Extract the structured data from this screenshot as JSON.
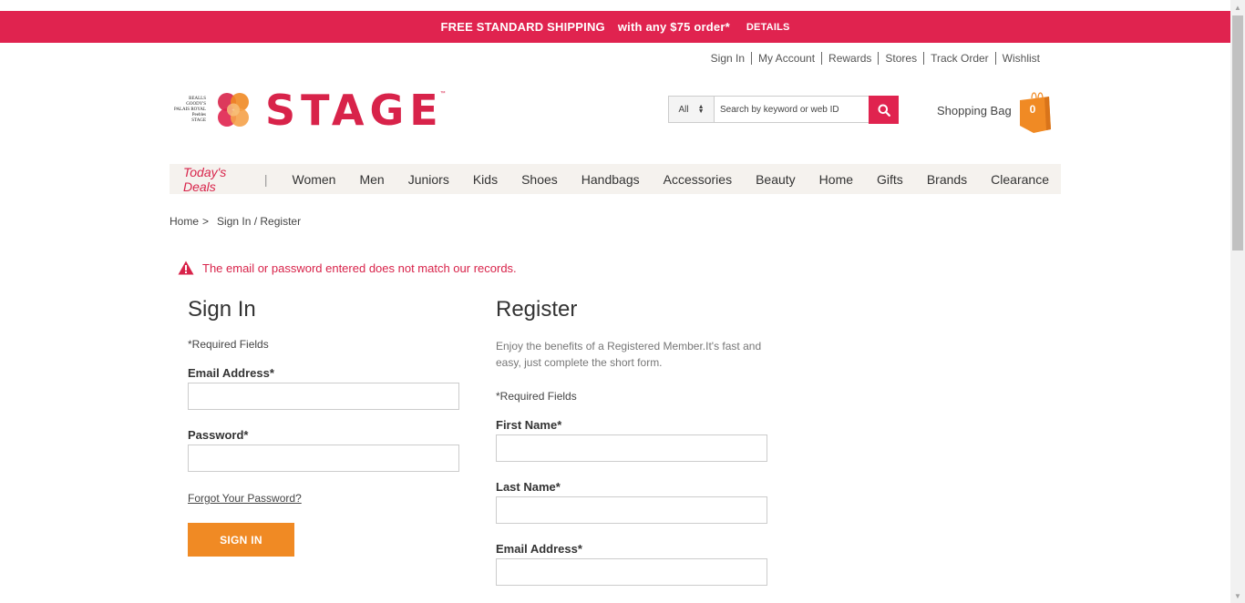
{
  "promo": {
    "headline": "FREE STANDARD SHIPPING",
    "condition": "with any $75 order*",
    "details": "DETAILS"
  },
  "util_links": [
    "Sign In",
    "My Account",
    "Rewards",
    "Stores",
    "Track Order",
    "Wishlist"
  ],
  "logo": {
    "text": "STAGE",
    "tm": "™",
    "subbrands": [
      "BEALLS",
      "GOODY'S",
      "PALAIS ROYAL",
      "Peebles",
      "STAGE"
    ]
  },
  "search": {
    "scope": "All",
    "placeholder": "Search by keyword or web ID"
  },
  "bag": {
    "label": "Shopping Bag",
    "count": "0"
  },
  "nav": {
    "deals": "Today's Deals",
    "separator": "|",
    "items": [
      "Women",
      "Men",
      "Juniors",
      "Kids",
      "Shoes",
      "Handbags",
      "Accessories",
      "Beauty",
      "Home",
      "Gifts",
      "Brands",
      "Clearance"
    ]
  },
  "breadcrumb": {
    "home": "Home",
    "sep": ">",
    "current": "Sign In / Register"
  },
  "error": "The email or password entered does not match our records.",
  "signin": {
    "title": "Sign In",
    "required": "*Required Fields",
    "email_label": "Email Address*",
    "password_label": "Password*",
    "forgot": "Forgot Your Password?",
    "button": "SIGN IN"
  },
  "register": {
    "title": "Register",
    "description": "Enjoy the benefits of a Registered Member.It's fast and easy, just complete the short form.",
    "required": "*Required Fields",
    "first_name_label": "First Name*",
    "last_name_label": "Last Name*",
    "email_label": "Email Address*"
  },
  "colors": {
    "brand": "#e0234f",
    "accent": "#f08a24",
    "nav_bg": "#f5f2ee"
  }
}
